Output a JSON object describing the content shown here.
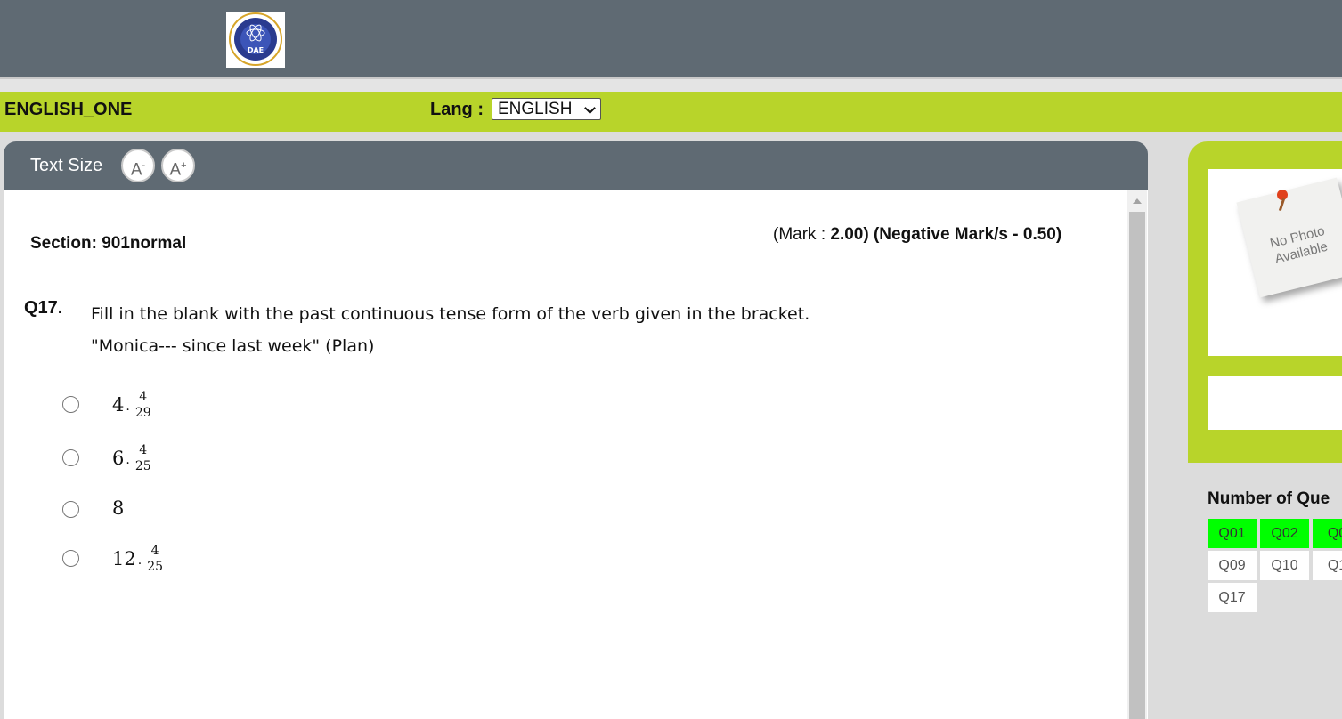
{
  "header": {
    "logo_text": "DAE"
  },
  "exam": {
    "name": "ENGLISH_ONE",
    "lang_label": "Lang :",
    "lang_value": "ENGLISH"
  },
  "toolbar": {
    "text_size_label": "Text Size",
    "decrease_label": "A",
    "decrease_sup": "-",
    "increase_label": "A",
    "increase_sup": "+"
  },
  "question": {
    "section": "Section: 901normal",
    "mark_prefix": "(Mark : ",
    "mark_value": "2.00)",
    "negative": "(Negative Mark/s - 0.50)",
    "number": "Q17.",
    "text_line1": "Fill in the blank with the past continuous tense form of the verb given in the bracket.",
    "text_line2": "\"Monica--- since last week\" (Plan)",
    "options": [
      {
        "whole": "4",
        "num": "4",
        "den": "29"
      },
      {
        "whole": "6",
        "num": "4",
        "den": "25"
      },
      {
        "whole": "8",
        "num": "",
        "den": ""
      },
      {
        "whole": "12",
        "num": "4",
        "den": "25"
      }
    ]
  },
  "sidebar": {
    "photo_text": "No Photo Available",
    "number_of_questions_label": "Number of Que",
    "question_buttons": [
      {
        "label": "Q01",
        "status": "answered"
      },
      {
        "label": "Q02",
        "status": "answered"
      },
      {
        "label": "Q0",
        "status": "answered"
      },
      {
        "label": "Q09",
        "status": "not-answered"
      },
      {
        "label": "Q10",
        "status": "not-answered"
      },
      {
        "label": "Q1",
        "status": "not-answered"
      },
      {
        "label": "Q17",
        "status": "not-answered"
      }
    ]
  },
  "colors": {
    "header_gray": "#5f6a73",
    "accent_green": "#b8d42a",
    "answered_green": "#00ff00"
  }
}
